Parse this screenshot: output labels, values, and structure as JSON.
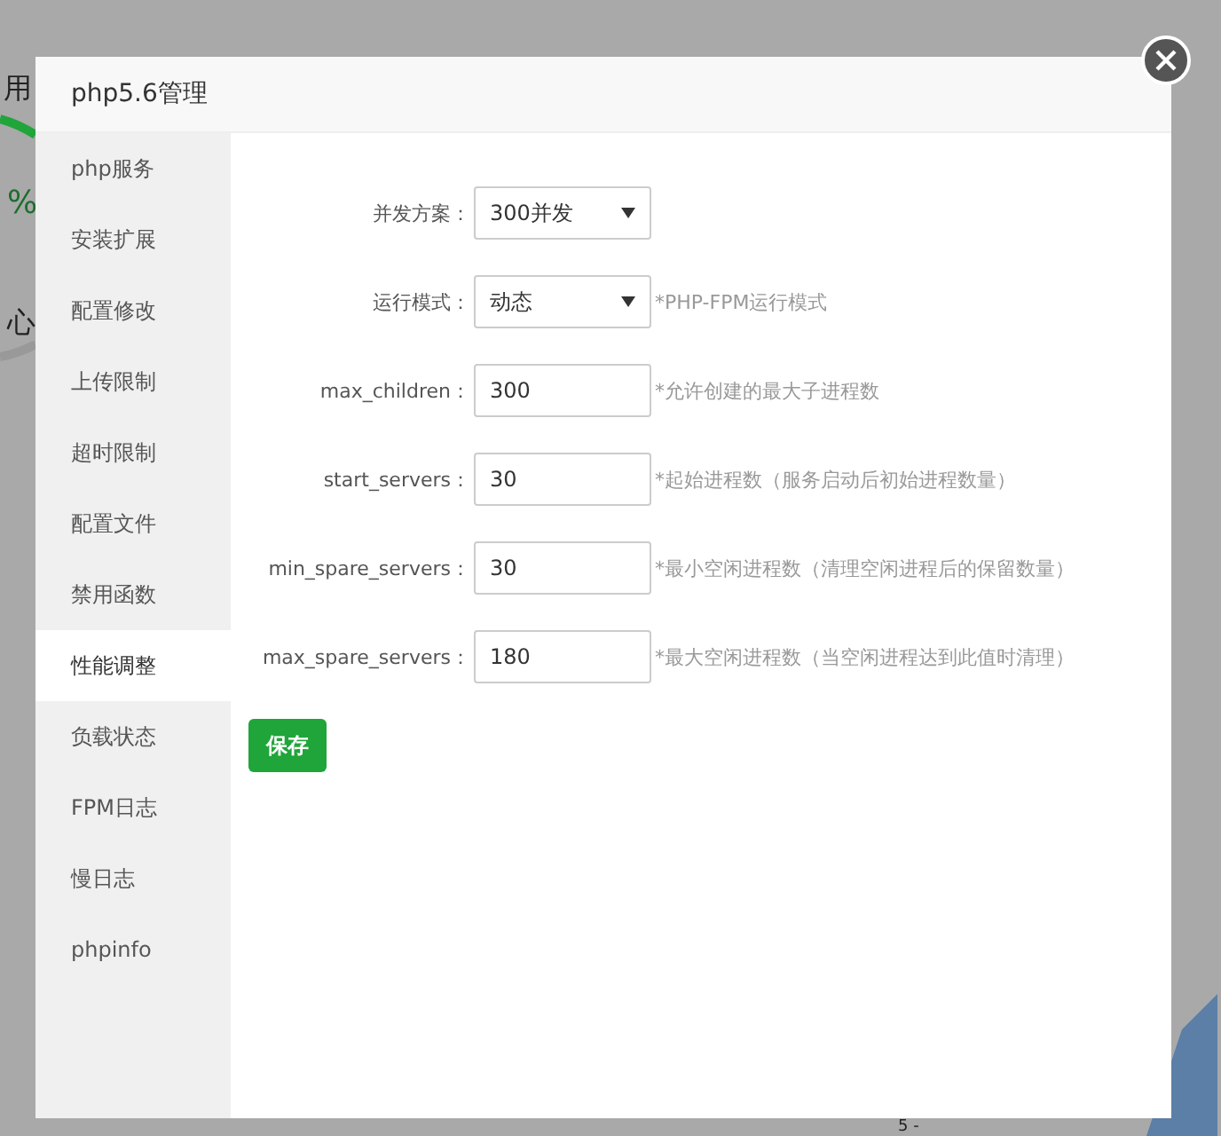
{
  "backdrop": {
    "texts": [
      "用",
      "%",
      "心",
      "5 -"
    ]
  },
  "dialog": {
    "title": "php5.6管理"
  },
  "sidebar": {
    "items": [
      {
        "label": "php服务",
        "selected": false
      },
      {
        "label": "安装扩展",
        "selected": false
      },
      {
        "label": "配置修改",
        "selected": false
      },
      {
        "label": "上传限制",
        "selected": false
      },
      {
        "label": "超时限制",
        "selected": false
      },
      {
        "label": "配置文件",
        "selected": false
      },
      {
        "label": "禁用函数",
        "selected": false
      },
      {
        "label": "性能调整",
        "selected": true
      },
      {
        "label": "负载状态",
        "selected": false
      },
      {
        "label": "FPM日志",
        "selected": false
      },
      {
        "label": "慢日志",
        "selected": false
      },
      {
        "label": "phpinfo",
        "selected": false
      }
    ]
  },
  "form": {
    "rows": [
      {
        "kind": "select",
        "label": "并发方案：",
        "value": "300并发"
      },
      {
        "kind": "select",
        "label": "运行模式：",
        "value": "动态",
        "hint": "*PHP-FPM运行模式"
      },
      {
        "kind": "input",
        "label": "max_children：",
        "value": "300",
        "hint": "*允许创建的最大子进程数"
      },
      {
        "kind": "input",
        "label": "start_servers：",
        "value": "30",
        "hint": "*起始进程数（服务启动后初始进程数量）"
      },
      {
        "kind": "input",
        "label": "min_spare_servers：",
        "value": "30",
        "hint": "*最小空闲进程数（清理空闲进程后的保留数量）"
      },
      {
        "kind": "input",
        "label": "max_spare_servers：",
        "value": "180",
        "hint": "*最大空闲进程数（当空闲进程达到此值时清理）"
      }
    ],
    "save_button": "保存"
  }
}
